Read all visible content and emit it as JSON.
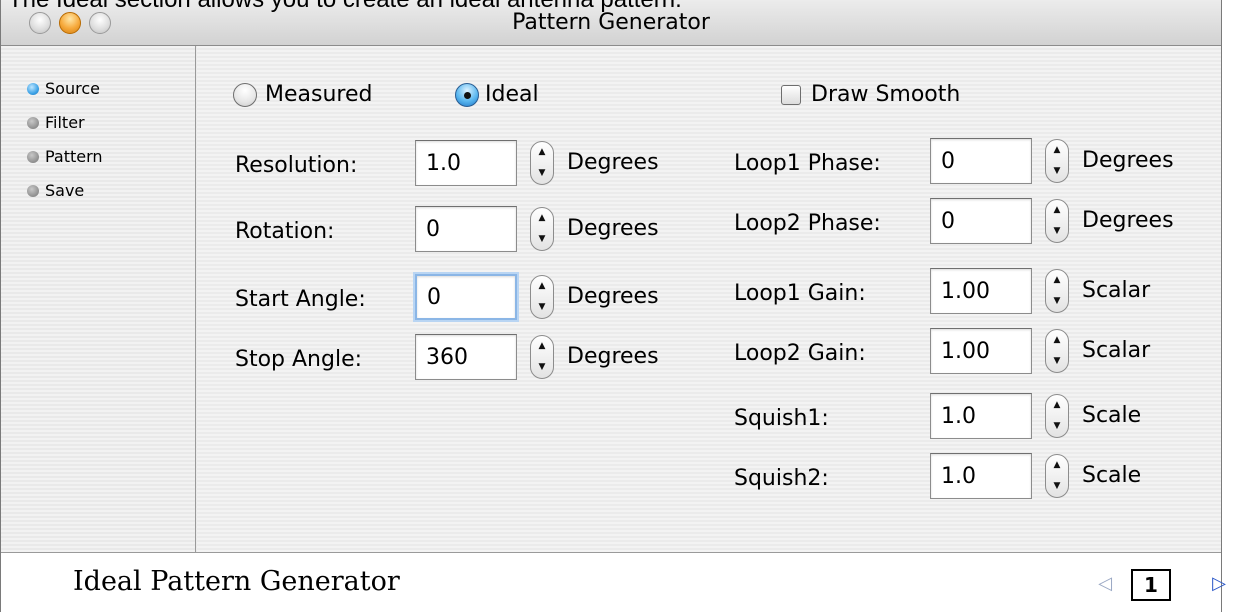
{
  "caption": "The Ideal section allows you to create an ideal antenna pattern.",
  "window": {
    "title": "Pattern Generator"
  },
  "sidebar": {
    "steps": [
      {
        "label": "Source",
        "active": true
      },
      {
        "label": "Filter",
        "active": false
      },
      {
        "label": "Pattern",
        "active": false
      },
      {
        "label": "Save",
        "active": false
      }
    ]
  },
  "source": {
    "options": [
      {
        "label": "Measured",
        "checked": false
      },
      {
        "label": "Ideal",
        "checked": true
      }
    ],
    "draw_smooth": {
      "label": "Draw Smooth",
      "checked": false
    }
  },
  "left_params": [
    {
      "label": "Resolution:",
      "value": "1.0",
      "unit": "Degrees"
    },
    {
      "label": "Rotation:",
      "value": "0",
      "unit": "Degrees"
    },
    {
      "label": "Start Angle:",
      "value": "0",
      "unit": "Degrees",
      "focused": true
    },
    {
      "label": "Stop Angle:",
      "value": "360",
      "unit": "Degrees"
    }
  ],
  "right_params": [
    {
      "label": "Loop1 Phase:",
      "value": "0",
      "unit": "Degrees"
    },
    {
      "label": "Loop2 Phase:",
      "value": "0",
      "unit": "Degrees"
    },
    {
      "label": "Loop1 Gain:",
      "value": "1.00",
      "unit": "Scalar"
    },
    {
      "label": "Loop2 Gain:",
      "value": "1.00",
      "unit": "Scalar"
    },
    {
      "label": "Squish1:",
      "value": "1.0",
      "unit": "Scale"
    },
    {
      "label": "Squish2:",
      "value": "1.0",
      "unit": "Scale"
    }
  ],
  "footer": {
    "title": "Ideal Pattern Generator",
    "page": "1",
    "prev_icon": "triangle-left-icon",
    "next_icon": "triangle-right-icon"
  },
  "colors": {
    "selected_step": "#3ca2e6",
    "focus_ring": "#8bb6e6",
    "pager_next": "#2a57c8",
    "pager_prev": "#9aa8c4"
  }
}
